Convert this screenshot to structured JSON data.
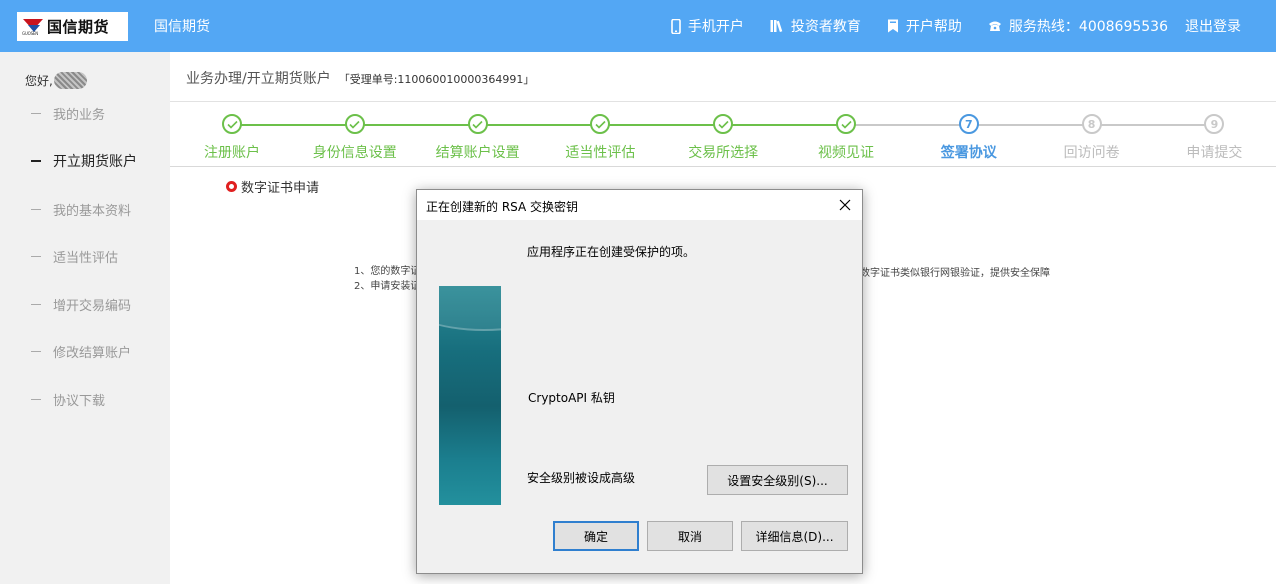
{
  "header": {
    "logo_text": "国信期货",
    "logo_sub": "GUOSEN",
    "brand": "国信期货",
    "nav": {
      "mobile": "手机开户",
      "education": "投资者教育",
      "help": "开户帮助",
      "hotline": "服务热线：4008695536",
      "logout": "退出登录"
    }
  },
  "sidebar": {
    "greeting": "您好,",
    "items": [
      {
        "label": "我的业务"
      },
      {
        "label": "开立期货账户"
      },
      {
        "label": "我的基本资料"
      },
      {
        "label": "适当性评估"
      },
      {
        "label": "增开交易编码"
      },
      {
        "label": "修改结算账户"
      },
      {
        "label": "协议下载"
      }
    ]
  },
  "breadcrumb": {
    "path": "业务办理/开立期货账户",
    "receipt": "「受理单号:110060010000364991」"
  },
  "steps": [
    {
      "label": "注册账户",
      "num": "1",
      "status": "done"
    },
    {
      "label": "身份信息设置",
      "num": "2",
      "status": "done"
    },
    {
      "label": "结算账户设置",
      "num": "3",
      "status": "done"
    },
    {
      "label": "适当性评估",
      "num": "4",
      "status": "done"
    },
    {
      "label": "交易所选择",
      "num": "5",
      "status": "done"
    },
    {
      "label": "视频见证",
      "num": "6",
      "status": "done"
    },
    {
      "label": "签署协议",
      "num": "7",
      "status": "current"
    },
    {
      "label": "回访问卷",
      "num": "8",
      "status": "todo"
    },
    {
      "label": "申请提交",
      "num": "9",
      "status": "todo"
    }
  ],
  "cert": {
    "title": "数字证书申请",
    "note1": "1、您的数字证",
    "note2": "2、申请安装证",
    "note1_tail": "数字证书类似银行网银验证，提供安全保障"
  },
  "dialog": {
    "title": "正在创建新的 RSA 交换密钥",
    "message": "应用程序正在创建受保护的项。",
    "item": "CryptoAPI 私钥",
    "level_text": "安全级别被设成高级",
    "set_level_button": "设置安全级别(S)...",
    "ok_button": "确定",
    "cancel_button": "取消",
    "details_button": "详细信息(D)..."
  },
  "colors": {
    "header_bg": "#53a7f4",
    "done_green": "#6cc04a",
    "current_blue": "#4a98e0",
    "todo_gray": "#c9c9c9"
  }
}
